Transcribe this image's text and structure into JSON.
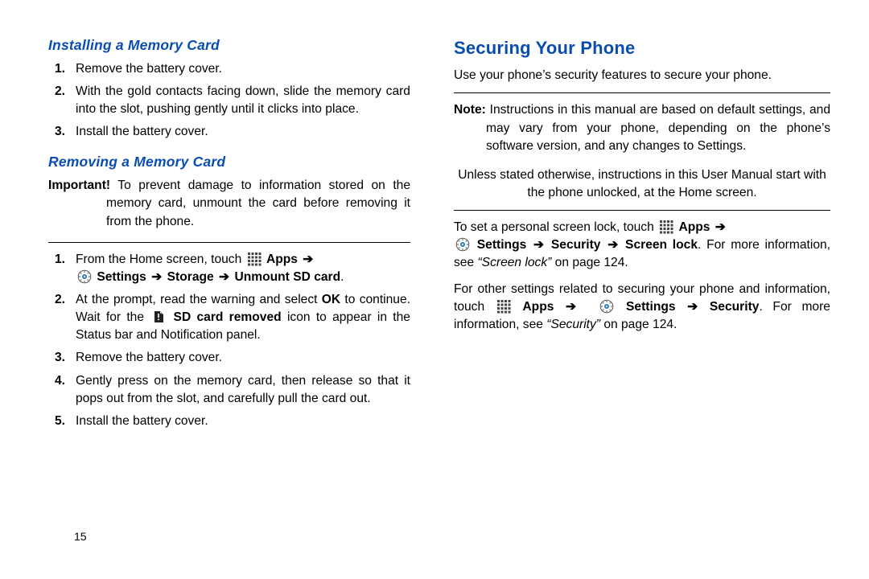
{
  "pageNumber": "15",
  "left": {
    "h_install": "Installing a Memory Card",
    "install": {
      "s1": "Remove the battery cover.",
      "s2": "With the gold contacts facing down, slide the memory card into the slot, pushing gently until it clicks into place.",
      "s3": "Install the battery cover."
    },
    "h_remove": "Removing a Memory Card",
    "important_lead": "Important!",
    "important_body": " To prevent damage to information stored on the memory card, unmount the card before removing it from the phone.",
    "rem": {
      "s1a": "From the Home screen, touch ",
      "apps": "Apps",
      "arrow": "➔",
      "settings": "Settings",
      "storage": "Storage",
      "unmount": "Unmount SD card",
      "period": ".",
      "s2a": "At the prompt, read the warning and select ",
      "ok": "OK",
      "s2b": " to continue. Wait for the ",
      "sdremoved": "SD card removed",
      "s2c": " icon to appear in the Status bar and Notification panel.",
      "s3": "Remove the battery cover.",
      "s4": "Gently press on the memory card, then release so that it pops out from the slot, and carefully pull the card out.",
      "s5": "Install the battery cover."
    }
  },
  "right": {
    "h1": "Securing Your Phone",
    "intro": "Use your phone’s security features to secure your phone.",
    "note_lead": "Note:",
    "note_body": " Instructions in this manual are based on default settings, and may vary from your phone, depending on the phone’s software version, and any changes to Settings.",
    "unless": "Unless stated otherwise, instructions in this User Manual start with the phone unlocked, at the Home screen.",
    "set1a": "To set a personal screen lock, touch ",
    "apps": "Apps",
    "arrow": "➔",
    "settings": "Settings",
    "security": "Security",
    "screenlock": "Screen lock",
    "set1b": ". For more information, see ",
    "ref1": "“Screen lock”",
    "on": " on page 124.",
    "set2a": "For other settings related to securing your phone and information, touch ",
    "set2b": ". For more information, see ",
    "ref2": "“Security”",
    "on2": " on page 124."
  }
}
